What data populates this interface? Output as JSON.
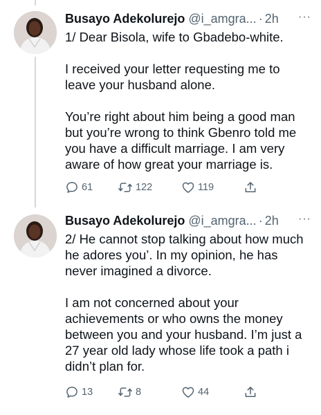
{
  "tweets": [
    {
      "author_name": "Busayo Adekolurejo",
      "handle": "@i_amgra...",
      "separator": "·",
      "time": "2h",
      "more": "···",
      "text": "1/ Dear Bisola, wife to Gbadebo-white.\n\nI received your letter requesting me to leave your husband alone.\n\nYou’re right about him being a good man but you’re wrong to think Gbenro told me you have a difficult marriage. I am very aware of how great your marriage is.",
      "replies": "61",
      "retweets": "122",
      "likes": "119",
      "icons": {
        "reply": "reply-icon",
        "retweet": "retweet-icon",
        "like": "heart-icon",
        "share": "share-icon"
      }
    },
    {
      "author_name": "Busayo Adekolurejo",
      "handle": "@i_amgra...",
      "separator": "·",
      "time": "2h",
      "more": "···",
      "text": "2/ He cannot stop talking about how much he adores you’. In my opinion, he has never imagined a divorce.\n\nI am not concerned about your achievements or who owns the money between you and your husband. I’m just a 27 year old lady whose life took a path i didn’t plan for.",
      "replies": "13",
      "retweets": "8",
      "likes": "44",
      "icons": {
        "reply": "reply-icon",
        "retweet": "retweet-icon",
        "like": "heart-icon",
        "share": "share-icon"
      }
    }
  ],
  "colors": {
    "text": "#0f1419",
    "secondary": "#536471",
    "thread_line": "#cfd9de",
    "background": "#ffffff"
  }
}
